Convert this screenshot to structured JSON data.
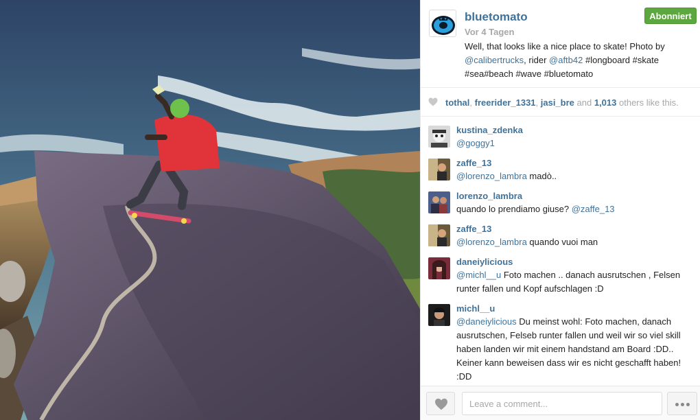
{
  "post": {
    "username": "bluetomato",
    "time_ago": "Vor 4 Tagen",
    "follow_label": "Abonniert",
    "caption": [
      {
        "text": "Well, that looks like a nice place to skate! Photo by ",
        "link": false
      },
      {
        "text": "@calibertrucks",
        "link": true
      },
      {
        "text": ", rider ",
        "link": false
      },
      {
        "text": "@aftb42",
        "link": true
      },
      {
        "text": " #longboard #skate #sea#beach #wave #bluetomato",
        "link": false
      }
    ]
  },
  "likes": {
    "user1": "tothal",
    "sep1": ", ",
    "user2": "freerider_1331",
    "sep2": ", ",
    "user3": "jasi_bre",
    "and_text": " and ",
    "count": "1,013",
    "suffix": " others like this."
  },
  "comments": [
    {
      "user": "kustina_zdenka",
      "avatar": "avatar-kustina",
      "parts": [
        {
          "text": "@goggy1",
          "link": true
        }
      ]
    },
    {
      "user": "zaffe_13",
      "avatar": "avatar-zaffe",
      "parts": [
        {
          "text": "@lorenzo_lambra",
          "link": true
        },
        {
          "text": " madò..",
          "link": false
        }
      ]
    },
    {
      "user": "lorenzo_lambra",
      "avatar": "avatar-lorenzo",
      "parts": [
        {
          "text": "quando lo prendiamo giuse? ",
          "link": false
        },
        {
          "text": "@zaffe_13",
          "link": true
        }
      ]
    },
    {
      "user": "zaffe_13",
      "avatar": "avatar-zaffe",
      "parts": [
        {
          "text": "@lorenzo_lambra",
          "link": true
        },
        {
          "text": " quando vuoi man",
          "link": false
        }
      ]
    },
    {
      "user": "daneiylicious",
      "avatar": "avatar-daneiy",
      "parts": [
        {
          "text": "@michl__u",
          "link": true
        },
        {
          "text": " Foto machen .. danach ausrutschen , Felsen runter fallen und Kopf aufschlagen :D",
          "link": false
        }
      ]
    },
    {
      "user": "michl__u",
      "avatar": "avatar-michl",
      "parts": [
        {
          "text": "@daneiylicious",
          "link": true
        },
        {
          "text": " Du meinst wohl: Foto machen, danach ausrutschen, Felseb runter fallen und weil wir so viel skill haben landen wir mit einem handstand am Board :DD.. Keiner kann beweisen dass wir es nicht geschafft haben! :DD",
          "link": false
        }
      ]
    }
  ],
  "footer": {
    "comment_placeholder": "Leave a comment..."
  },
  "colors": {
    "link": "#3f729b",
    "follow_button": "#5ca740",
    "muted": "#a5a7aa"
  }
}
